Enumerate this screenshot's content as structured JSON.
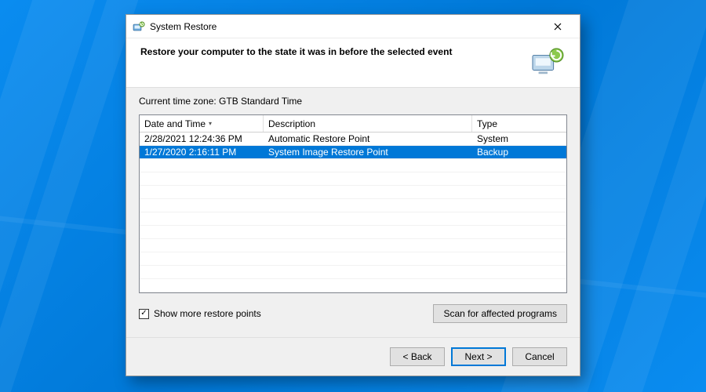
{
  "window": {
    "title": "System Restore"
  },
  "header": {
    "heading": "Restore your computer to the state it was in before the selected event"
  },
  "content": {
    "timezone_label": "Current time zone: GTB Standard Time",
    "columns": {
      "date": "Date and Time",
      "description": "Description",
      "type": "Type"
    },
    "rows": [
      {
        "date": "2/28/2021 12:24:36 PM",
        "description": "Automatic Restore Point",
        "type": "System",
        "selected": false
      },
      {
        "date": "1/27/2020 2:16:11 PM",
        "description": "System Image Restore Point",
        "type": "Backup",
        "selected": true
      }
    ],
    "show_more_label": "Show more restore points",
    "show_more_checked": true,
    "scan_button_label": "Scan for affected programs"
  },
  "footer": {
    "back": "< Back",
    "next": "Next >",
    "cancel": "Cancel"
  }
}
